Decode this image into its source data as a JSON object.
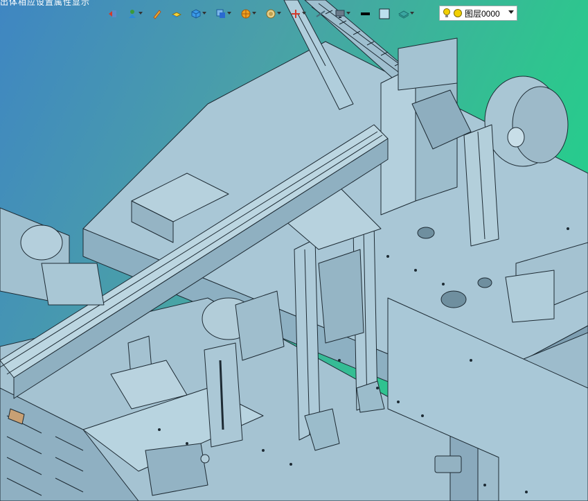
{
  "window": {
    "title_fragment": "出体相应设置属性显示"
  },
  "toolbar": {
    "buttons": [
      {
        "name": "back",
        "icon": "arrow-left-icon",
        "color": "#d23a2a",
        "dropdown": false
      },
      {
        "name": "move",
        "icon": "move-icon",
        "color": "#3a9a3a",
        "dropdown": true
      },
      {
        "name": "pen",
        "icon": "pen-icon",
        "color": "#e05a2a",
        "dropdown": false
      },
      {
        "name": "box-yellow",
        "icon": "block-icon",
        "color": "#e6c230",
        "dropdown": false
      },
      {
        "name": "cube",
        "icon": "cube-icon",
        "color": "#2a8ad8",
        "dropdown": true
      },
      {
        "name": "view",
        "icon": "view-icon",
        "color": "#2a6ad0",
        "dropdown": true
      },
      {
        "name": "render",
        "icon": "render-sphere-icon",
        "color": "#f0a020",
        "dropdown": true
      },
      {
        "name": "appearance",
        "icon": "appearance-icon",
        "color": "#e0b040",
        "dropdown": true
      },
      {
        "name": "axes",
        "icon": "axes-icon",
        "color": "#d23a2a",
        "dropdown": true
      },
      {
        "name": "display",
        "icon": "display-icon",
        "color": "#6a7a8a",
        "dropdown": true
      },
      {
        "name": "line-color",
        "icon": "line-color-icon",
        "color": "#000000",
        "dropdown": false
      },
      {
        "name": "fill-color",
        "icon": "fill-color-icon",
        "color": "#bde0ee",
        "dropdown": false
      },
      {
        "name": "layers",
        "icon": "layers-icon",
        "color": "#3aa6a0",
        "dropdown": true
      }
    ]
  },
  "layer": {
    "current": "图层0000",
    "bulb_color": "#f2d000",
    "dot_color": "#f2d000"
  },
  "viewport": {
    "label": "3D CAD model view"
  }
}
